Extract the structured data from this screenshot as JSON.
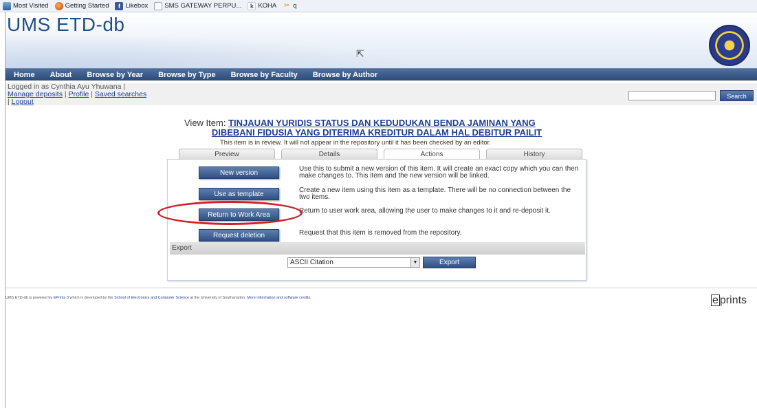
{
  "bookmarks": [
    {
      "label": "Most Visited",
      "icon": "most-visited-icon"
    },
    {
      "label": "Getting Started",
      "icon": "firefox-icon"
    },
    {
      "label": "Likebox",
      "icon": "facebook-icon"
    },
    {
      "label": "SMS GATEWAY PERPU...",
      "icon": "blank-page-icon"
    },
    {
      "label": "KOHA",
      "icon": "koha-icon"
    },
    {
      "label": "q",
      "icon": "q-icon"
    }
  ],
  "header": {
    "title": "UMS ETD-db"
  },
  "nav": [
    "Home",
    "About",
    "Browse by Year",
    "Browse by Type",
    "Browse by Faculty",
    "Browse by Author"
  ],
  "login": {
    "prefix": "Logged in as Cynthia Ayu Yhuwana |",
    "manage": "Manage deposits",
    "profile": "Profile",
    "saved": "Saved searches",
    "logout": "Logout",
    "sep": "|"
  },
  "search": {
    "value": "",
    "button": "Search"
  },
  "item": {
    "label": "View Item:",
    "title_line1": "TINJAUAN YURIDIS STATUS DAN KEDUDUKAN BENDA JAMINAN YANG",
    "title_line2": "DIBEBANI FIDUSIA YANG DITERIMA KREDITUR DALAM HAL DEBITUR PAILIT",
    "review_note": "This item is in review. It will not appear in the repository until it has been checked by an editor."
  },
  "tabs": [
    {
      "label": "Preview",
      "active": false
    },
    {
      "label": "Details",
      "active": false
    },
    {
      "label": "Actions",
      "active": true
    },
    {
      "label": "History",
      "active": false
    }
  ],
  "actions": [
    {
      "button": "New version",
      "desc": "Use this to submit a new version of this item. It will create an exact copy which you can then make changes to. This item and the new version will be linked."
    },
    {
      "button": "Use as template",
      "desc": "Create a new item using this item as a template. There will be no connection between the two items."
    },
    {
      "button": "Return to Work Area",
      "desc": "Return to user work area, allowing the user to make changes to it and re-deposit it."
    },
    {
      "button": "Request deletion",
      "desc": "Request that this item is removed from the repository."
    }
  ],
  "export": {
    "heading": "Export",
    "selected": "ASCII Citation",
    "button": "Export"
  },
  "footer": {
    "text1": "UMS ETD-db is powered by ",
    "link1": "EPrints 3",
    "text2": " which is developed by the ",
    "link2": "School of Electronics and Computer Science",
    "text3": " at the University of Southampton. ",
    "link3": "More information and software credits",
    "text4": "."
  },
  "eprints_logo": {
    "box": "e",
    "rest": "prints"
  }
}
